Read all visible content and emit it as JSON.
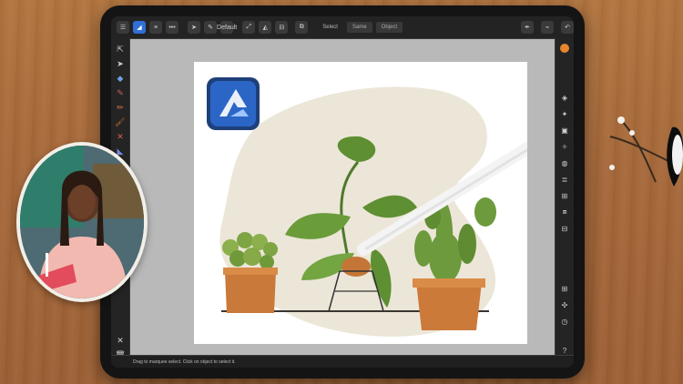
{
  "toolbar": {
    "persona_label": "Default",
    "select_label": "Select",
    "same_label": "Same",
    "object_label": "Object"
  },
  "status": {
    "hint": "Drag to marquee select. Click on object to select it."
  },
  "colors": {
    "accent": "#e8862d",
    "ui_dark": "#2c2c2c",
    "canvas_bg": "#b9b9b9"
  },
  "icons": {
    "app_logo": "affinity-designer-logo-icon",
    "pencil": "apple-pencil"
  }
}
